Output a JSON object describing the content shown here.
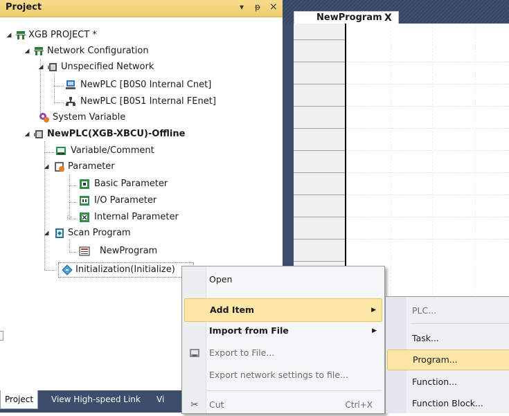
{
  "project_pane": {
    "title": "Project",
    "buttons": {
      "dropdown": "▾",
      "pin": "ᵽ",
      "close": "×"
    },
    "tree": [
      {
        "label": "XGB PROJECT *",
        "icon": "project-icon",
        "bold": false
      },
      {
        "label": "Network Configuration",
        "icon": "network-config-icon",
        "bold": false
      },
      {
        "label": "Unspecified Network",
        "icon": "network-icon",
        "bold": false
      },
      {
        "label": "NewPLC [B0S0 Internal Cnet]",
        "icon": "cnet-icon",
        "bold": false
      },
      {
        "label": "NewPLC [B0S1 Internal FEnet]",
        "icon": "fenet-icon",
        "bold": false
      },
      {
        "label": "System Variable",
        "icon": "system-variable-icon",
        "bold": false
      },
      {
        "label": "NewPLC(XGB-XBCU)-Offline",
        "icon": "plc-icon",
        "bold": true
      },
      {
        "label": "Variable/Comment",
        "icon": "variable-comment-icon",
        "bold": false
      },
      {
        "label": "Parameter",
        "icon": "parameter-icon",
        "bold": false
      },
      {
        "label": "Basic Parameter",
        "icon": "basic-parameter-icon",
        "bold": false
      },
      {
        "label": "I/O Parameter",
        "icon": "io-parameter-icon",
        "bold": false
      },
      {
        "label": "Internal Parameter",
        "icon": "internal-parameter-icon",
        "bold": false
      },
      {
        "label": "Scan Program",
        "icon": "scan-program-icon",
        "bold": false
      },
      {
        "label": "NewProgram",
        "icon": "program-icon",
        "bold": false
      },
      {
        "label": "Initialization(Initialize)",
        "icon": "initialization-icon",
        "bold": false
      }
    ],
    "bottom_tabs": [
      "Project",
      "View High-speed Link",
      "Vi"
    ]
  },
  "editor": {
    "tab_label": "NewProgram",
    "tab_close": "X"
  },
  "context_menu": {
    "items": [
      {
        "label": "Open",
        "state": "normal"
      },
      {
        "label": "Add Item",
        "state": "highlighted",
        "arrow": "▶"
      },
      {
        "label": "Import from File",
        "state": "normal",
        "arrow": "▶"
      },
      {
        "label": "Export to File...",
        "state": "disabled",
        "icon": "export-icon"
      },
      {
        "label": "Export network settings to file...",
        "state": "disabled"
      },
      {
        "label": "Cut",
        "state": "disabled",
        "icon": "scissors-icon",
        "shortcut": "Ctrl+X"
      }
    ]
  },
  "submenu": {
    "items": [
      {
        "label": "PLC...",
        "state": "disabled"
      },
      {
        "label": "Task...",
        "state": "normal"
      },
      {
        "label": "Program...",
        "state": "highlighted"
      },
      {
        "label": "Function...",
        "state": "normal"
      },
      {
        "label": "Function Block...",
        "state": "normal"
      }
    ]
  },
  "colors": {
    "pane_header": "#f0cd6c",
    "highlight": "#fde7a6",
    "dark_frame": "#3c4e6c"
  }
}
